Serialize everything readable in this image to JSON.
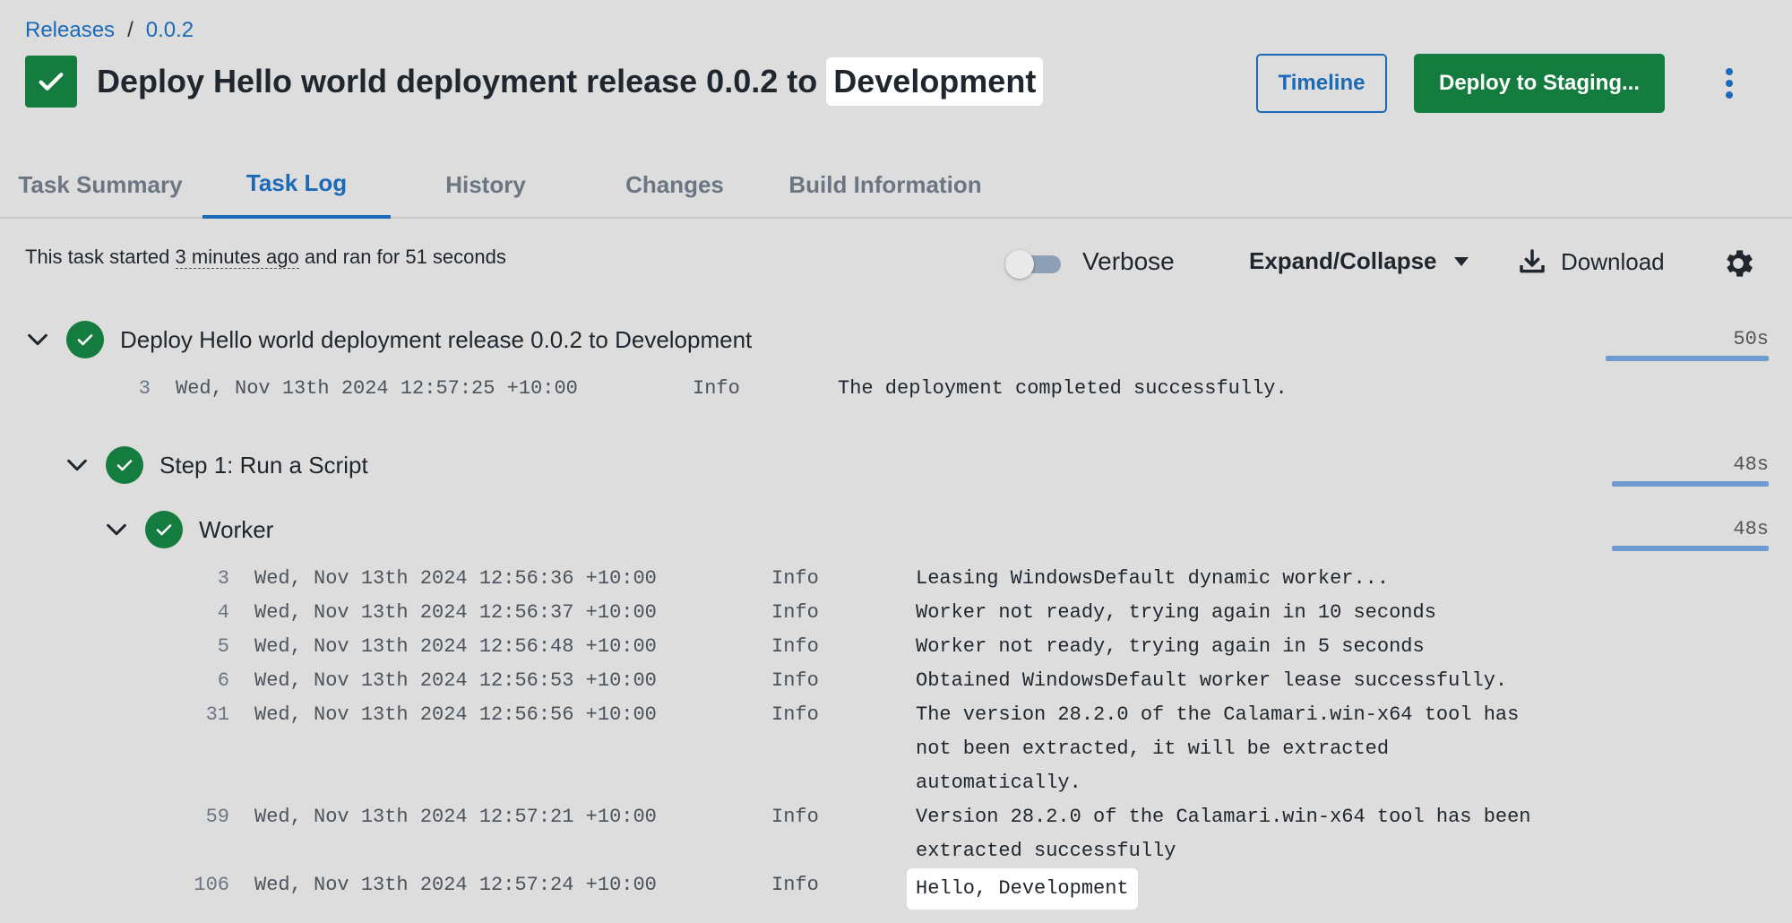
{
  "breadcrumb": {
    "parent": "Releases",
    "separator": "/",
    "current": "0.0.2"
  },
  "header": {
    "title_prefix": "Deploy Hello world deployment release 0.0.2 to ",
    "title_env": "Development",
    "timeline_label": "Timeline",
    "deploy_label": "Deploy to Staging..."
  },
  "tabs": [
    {
      "label": "Task Summary",
      "active": false
    },
    {
      "label": "Task Log",
      "active": true
    },
    {
      "label": "History",
      "active": false
    },
    {
      "label": "Changes",
      "active": false
    },
    {
      "label": "Build Information",
      "active": false
    }
  ],
  "toolbar": {
    "info_prefix": "This task started ",
    "info_ago": "3 minutes ago",
    "info_suffix": " and ran for 51 seconds",
    "verbose_label": "Verbose",
    "verbose_on": false,
    "expand_label": "Expand/Collapse",
    "download_label": "Download"
  },
  "colors": {
    "success": "#137c3e",
    "link": "#1a6ab8",
    "duration_bar": "#6f9bd1"
  },
  "log": {
    "root": {
      "label": "Deploy Hello world deployment release 0.0.2 to Development",
      "duration": "50s",
      "lines": [
        {
          "num": "3",
          "ts": "Wed, Nov 13th 2024 12:57:25 +10:00",
          "level": "Info",
          "msg": "The deployment completed successfully."
        }
      ]
    },
    "step": {
      "label": "Step 1: Run a Script",
      "duration": "48s"
    },
    "worker": {
      "label": "Worker",
      "duration": "48s",
      "lines": [
        {
          "num": "3",
          "ts": "Wed, Nov 13th 2024 12:56:36 +10:00",
          "level": "Info",
          "msg": "Leasing WindowsDefault dynamic worker..."
        },
        {
          "num": "4",
          "ts": "Wed, Nov 13th 2024 12:56:37 +10:00",
          "level": "Info",
          "msg": "Worker not ready, trying again in 10 seconds"
        },
        {
          "num": "5",
          "ts": "Wed, Nov 13th 2024 12:56:48 +10:00",
          "level": "Info",
          "msg": "Worker not ready, trying again in 5 seconds"
        },
        {
          "num": "6",
          "ts": "Wed, Nov 13th 2024 12:56:53 +10:00",
          "level": "Info",
          "msg": "Obtained WindowsDefault worker lease successfully."
        },
        {
          "num": "31",
          "ts": "Wed, Nov 13th 2024 12:56:56 +10:00",
          "level": "Info",
          "msg": "The version 28.2.0 of the Calamari.win-x64 tool has\nnot been extracted, it will be extracted\nautomatically."
        },
        {
          "num": "59",
          "ts": "Wed, Nov 13th 2024 12:57:21 +10:00",
          "level": "Info",
          "msg": "Version 28.2.0 of the Calamari.win-x64 tool has been\nextracted successfully"
        },
        {
          "num": "106",
          "ts": "Wed, Nov 13th 2024 12:57:24 +10:00",
          "level": "Info",
          "msg": "Hello, Development"
        }
      ]
    }
  }
}
